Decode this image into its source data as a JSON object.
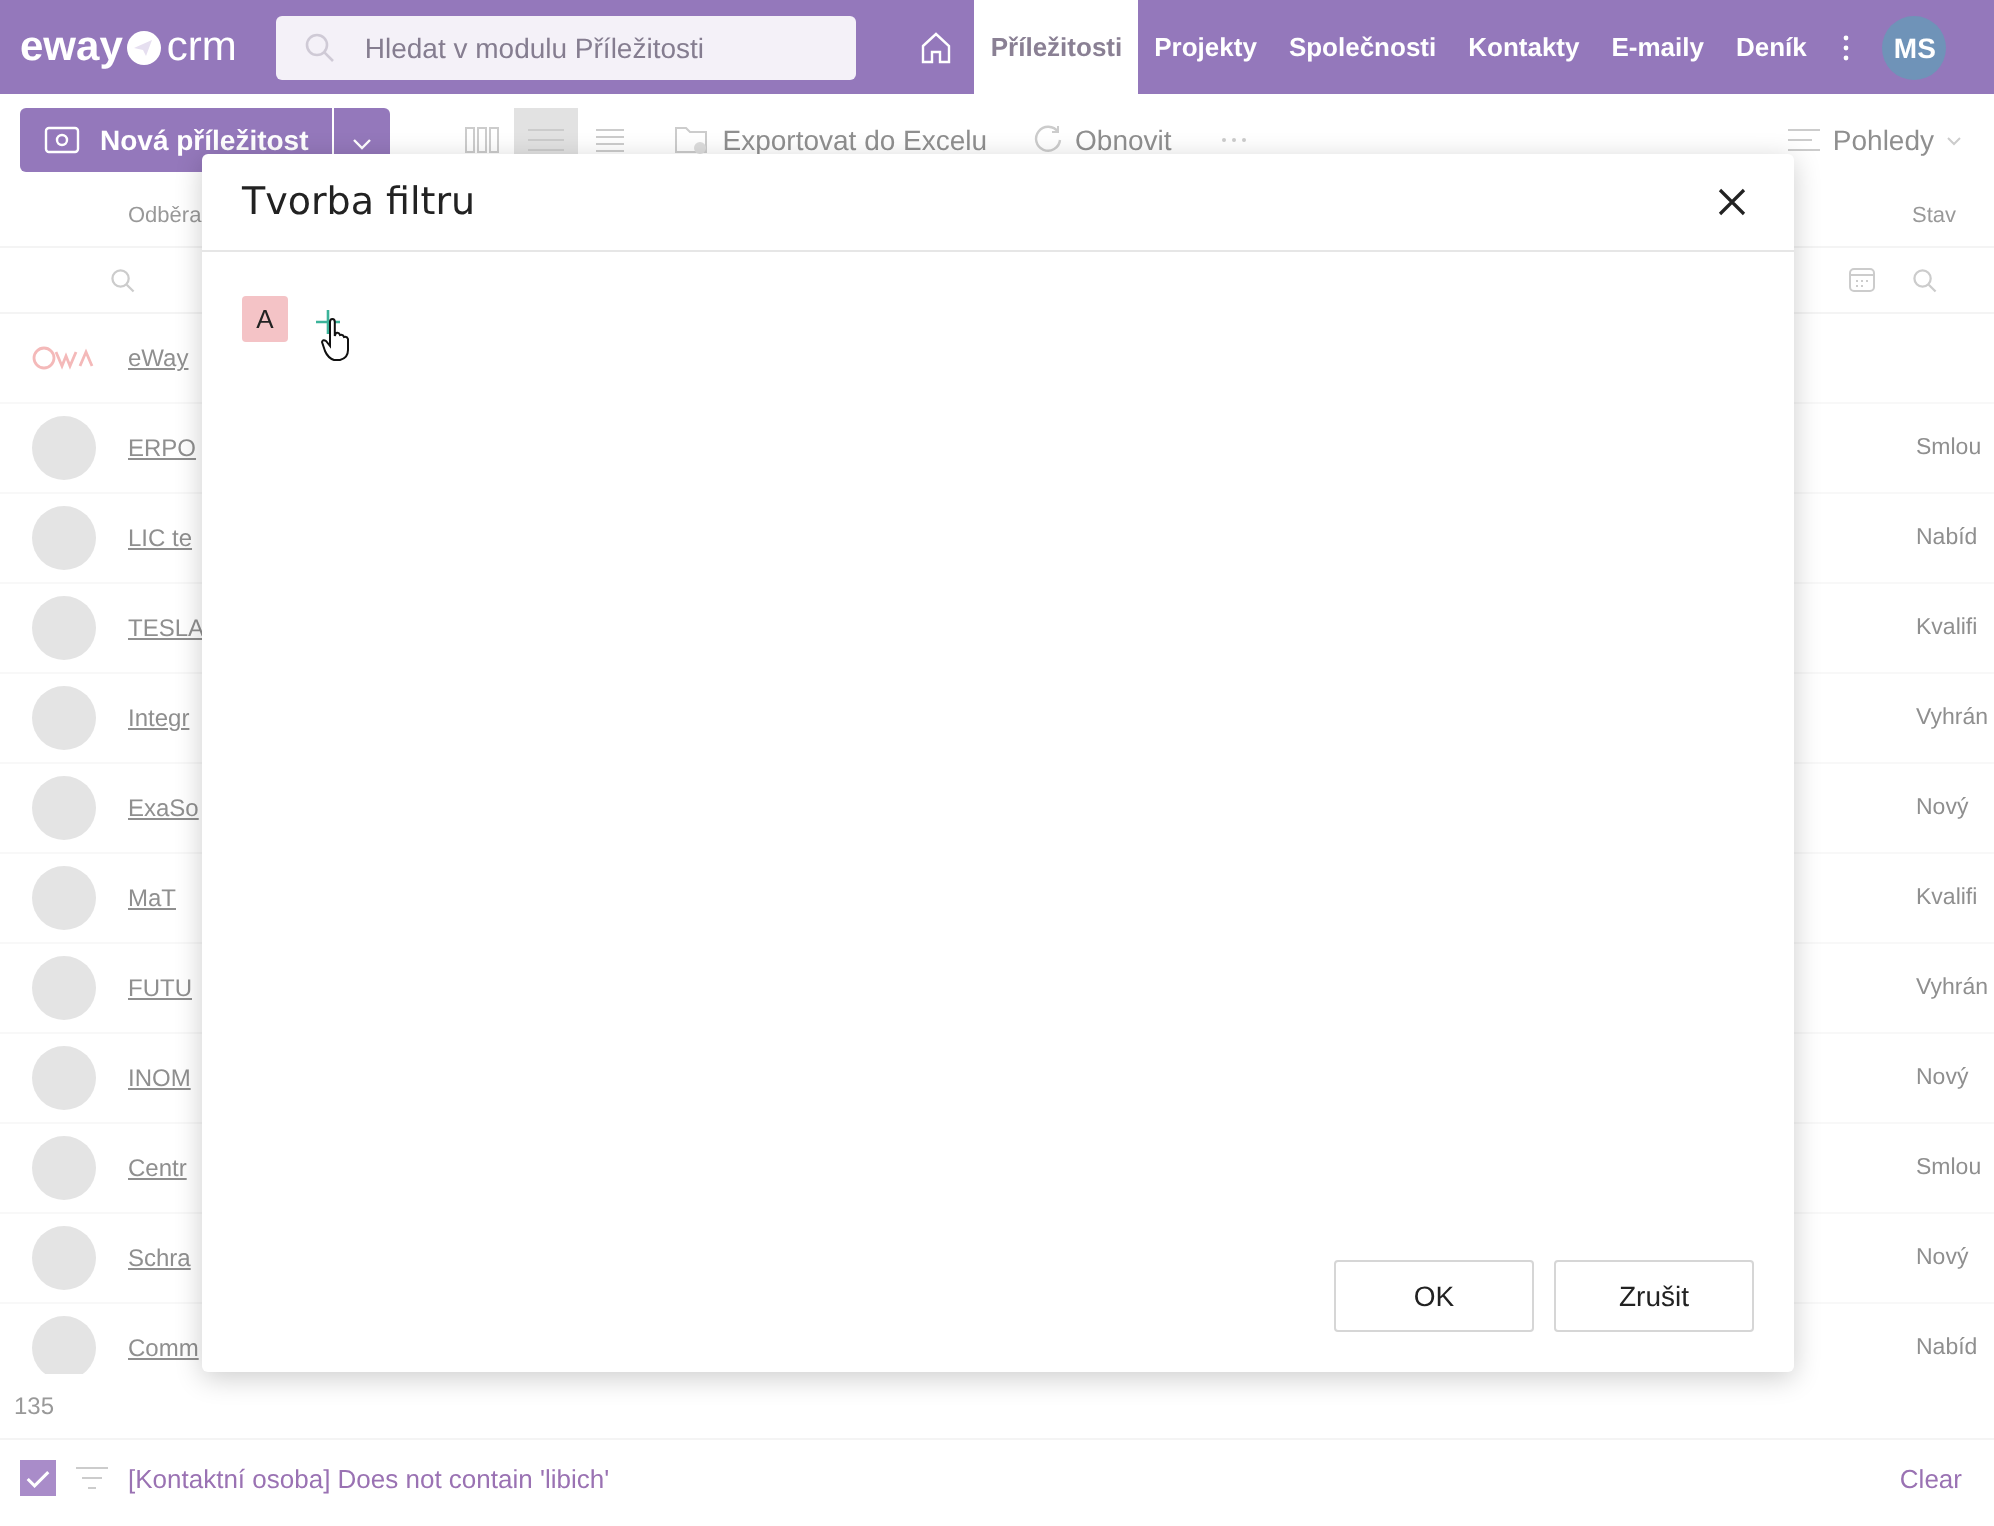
{
  "top_bar": {
    "logo": {
      "left": "eway",
      "right": "crm"
    },
    "search": {
      "placeholder": "Hledat v modulu Příležitosti"
    },
    "nav": [
      {
        "label": "Příležitosti",
        "selected": true
      },
      {
        "label": "Projekty",
        "selected": false
      },
      {
        "label": "Společnosti",
        "selected": false
      },
      {
        "label": "Kontakty",
        "selected": false
      },
      {
        "label": "E-maily",
        "selected": false
      },
      {
        "label": "Deník",
        "selected": false
      }
    ],
    "user_initials": "MS"
  },
  "toolbar": {
    "new_button": "Nová příležitost",
    "views": [
      {
        "kind": "columns",
        "selected": false
      },
      {
        "kind": "list",
        "selected": true
      },
      {
        "kind": "compact",
        "selected": false
      }
    ],
    "export": "Exportovat do Excelu",
    "refresh": "Obnovit",
    "views_menu": "Pohledy"
  },
  "table": {
    "columns": [
      "Odběra",
      "Stav"
    ],
    "rows": [
      {
        "kind": "logo",
        "name": "eWay",
        "status": ""
      },
      {
        "kind": "photo",
        "name": "ERPO",
        "status": "Smlou"
      },
      {
        "kind": "photo",
        "name": "LIC te",
        "status": "Nabíd"
      },
      {
        "kind": "photo",
        "name": "TESLA",
        "status": "Kvalifi"
      },
      {
        "kind": "photo",
        "name": "Integr",
        "status": "Vyhrán"
      },
      {
        "kind": "photo",
        "name": "ExaSo",
        "status": "Nový"
      },
      {
        "kind": "photo",
        "name": "MaT",
        "status": "Kvalifi"
      },
      {
        "kind": "photo",
        "name": "FUTU",
        "status": "Vyhrán"
      },
      {
        "kind": "photo",
        "name": "INOM",
        "status": "Nový"
      },
      {
        "kind": "photo",
        "name": "Centr",
        "status": "Smlou"
      },
      {
        "kind": "photo",
        "name": "Schra",
        "status": "Nový"
      },
      {
        "kind": "photo",
        "name": "Comm",
        "status": "Nabíd"
      }
    ]
  },
  "count": "135",
  "filter_bar": {
    "checked": true,
    "text": "[Kontaktní osoba] Does not contain 'libich'",
    "clear": "Clear"
  },
  "dialog": {
    "title": "Tvorba filtru",
    "groups": [
      {
        "label": "A"
      }
    ],
    "buttons": [
      "OK",
      "Zrušit"
    ]
  }
}
